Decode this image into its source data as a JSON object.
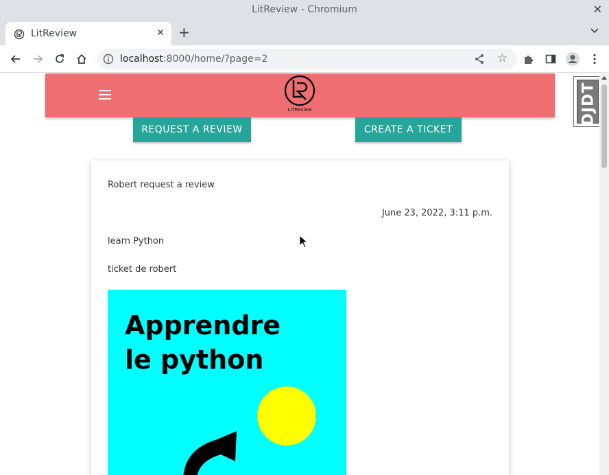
{
  "window": {
    "title": "LitReview - Chromium",
    "close_glyph": "✕"
  },
  "tab": {
    "title": "LitReview",
    "favicon": "litreview-favicon",
    "close_glyph": "✕",
    "new_tab_glyph": "+"
  },
  "toolbar": {
    "url_host": "localhost",
    "url_rest": ":8000/home/?page=2",
    "star_glyph": "☆"
  },
  "page": {
    "logo_text": "LITReview",
    "buttons": {
      "request_review": "REQUEST A REVIEW",
      "create_ticket": "CREATE A TICKET"
    },
    "debug_toolbar": "DJDT",
    "ticket": {
      "header": "Robert request a review",
      "date": "June 23, 2022, 3:11 p.m.",
      "title": "learn Python",
      "description": "ticket de robert",
      "cover_line1": "Apprendre",
      "cover_line2": "le python"
    }
  },
  "colors": {
    "navbar": "#ef6e71",
    "button": "#26a69a",
    "cover_bg": "#00ffff",
    "sun": "#ffff00"
  }
}
